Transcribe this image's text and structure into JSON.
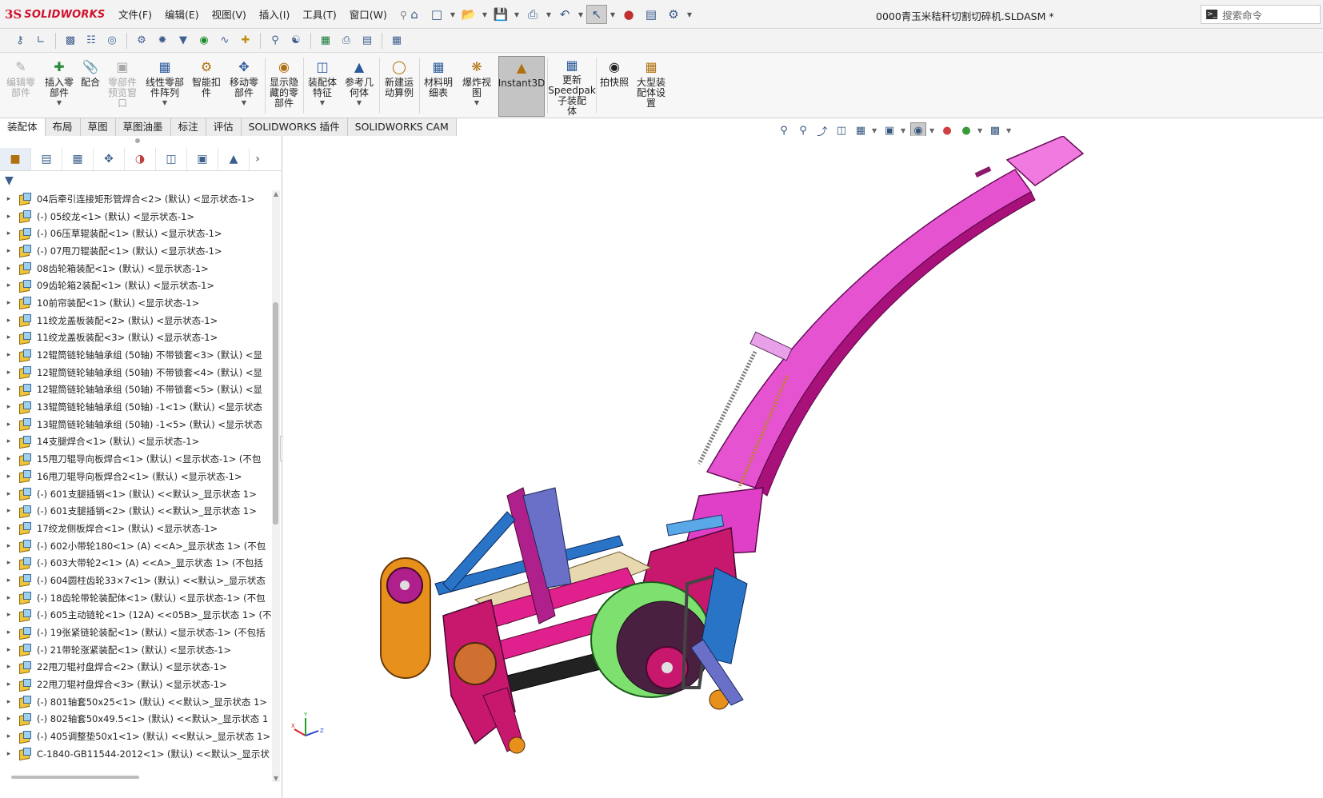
{
  "app": {
    "logo_mark": "3S",
    "logo_text": "SOLIDWORKS",
    "doc_title": "0000青玉米秸秆切割切碎机.SLDASM *",
    "search_placeholder": "搜索命令"
  },
  "menu": [
    "文件(F)",
    "编辑(E)",
    "视图(V)",
    "插入(I)",
    "工具(T)",
    "窗口(W)"
  ],
  "quick_access": [
    "home-icon",
    "new-icon",
    "open-icon",
    "save-icon",
    "print-icon",
    "undo-icon",
    "select-icon",
    "rebuild-icon",
    "options-icon",
    "settings-icon"
  ],
  "ribbon": [
    {
      "label": "编辑零\n部件",
      "disabled": true,
      "dd": false
    },
    {
      "label": "插入零\n部件",
      "disabled": false,
      "dd": true
    },
    {
      "label": "配合",
      "disabled": false,
      "dd": false
    },
    {
      "label": "零部件\n预览窗\n口",
      "disabled": true,
      "dd": false
    },
    {
      "label": "线性零部\n件阵列",
      "disabled": false,
      "dd": true
    },
    {
      "label": "智能扣\n件",
      "disabled": false,
      "dd": false
    },
    {
      "label": "移动零\n部件",
      "disabled": false,
      "dd": true
    },
    {
      "label": "显示隐\n藏的零\n部件",
      "disabled": false,
      "dd": false
    },
    {
      "label": "装配体\n特征",
      "disabled": false,
      "dd": true
    },
    {
      "label": "参考几\n何体",
      "disabled": false,
      "dd": true
    },
    {
      "label": "新建运\n动算例",
      "disabled": false,
      "dd": false
    },
    {
      "label": "材料明\n细表",
      "disabled": false,
      "dd": false
    },
    {
      "label": "爆炸视\n图",
      "disabled": false,
      "dd": true
    },
    {
      "label": "Instant3D",
      "disabled": false,
      "dd": false,
      "active": true
    },
    {
      "label": "更新\nSpeedpak\n子装配\n体",
      "disabled": false,
      "dd": false
    },
    {
      "label": "拍快照",
      "disabled": false,
      "dd": false
    },
    {
      "label": "大型装\n配体设\n置",
      "disabled": false,
      "dd": false
    }
  ],
  "tabs": [
    "装配体",
    "布局",
    "草图",
    "草图油墨",
    "标注",
    "评估",
    "SOLIDWORKS 插件",
    "SOLIDWORKS CAM"
  ],
  "tree": [
    "04后牵引连接矩形管焊合<2> (默认) <显示状态-1>",
    "(-) 05绞龙<1> (默认) <显示状态-1>",
    "(-) 06压草辊装配<1> (默认) <显示状态-1>",
    "(-) 07甩刀辊装配<1> (默认) <显示状态-1>",
    "08齿轮箱装配<1> (默认) <显示状态-1>",
    "09齿轮箱2装配<1> (默认) <显示状态-1>",
    "10前帘装配<1> (默认) <显示状态-1>",
    "11绞龙盖板装配<2> (默认) <显示状态-1>",
    "11绞龙盖板装配<3> (默认) <显示状态-1>",
    "12辊筒链轮轴轴承组 (50轴) 不带锁套<3> (默认) <显",
    "12辊筒链轮轴轴承组 (50轴) 不带锁套<4> (默认) <显",
    "12辊筒链轮轴轴承组 (50轴) 不带锁套<5> (默认) <显",
    "13辊筒链轮轴轴承组 (50轴) -1<1> (默认) <显示状态",
    "13辊筒链轮轴轴承组 (50轴) -1<5> (默认) <显示状态",
    "14支腿焊合<1> (默认) <显示状态-1>",
    "15甩刀辊导向板焊合<1> (默认) <显示状态-1> (不包",
    "16甩刀辊导向板焊合2<1> (默认) <显示状态-1>",
    "(-) 601支腿插销<1> (默认) <<默认>_显示状态 1>",
    "(-) 601支腿插销<2> (默认) <<默认>_显示状态 1>",
    "17绞龙侧板焊合<1> (默认) <显示状态-1>",
    "(-) 602小带轮180<1> (A) <<A>_显示状态 1> (不包",
    "(-) 603大带轮2<1> (A) <<A>_显示状态 1> (不包括",
    "(-) 604圆柱齿轮33×7<1> (默认) <<默认>_显示状态",
    "(-) 18齿轮带轮装配体<1> (默认) <显示状态-1> (不包",
    "(-) 605主动链轮<1> (12A) <<05B>_显示状态 1> (不",
    "(-) 19张紧链轮装配<1> (默认) <显示状态-1> (不包括",
    "(-) 21带轮涨紧装配<1> (默认) <显示状态-1>",
    "22甩刀辊衬盘焊合<2> (默认) <显示状态-1>",
    "22甩刀辊衬盘焊合<3> (默认) <显示状态-1>",
    "(-) 801轴套50x25<1> (默认) <<默认>_显示状态 1>",
    "(-) 802轴套50x49.5<1> (默认) <<默认>_显示状态 1",
    "(-) 405调整垫50x1<1> (默认) <<默认>_显示状态 1>",
    "C-1840-GB11544-2012<1> (默认) <<默认>_显示状"
  ],
  "triad": {
    "x": "X",
    "y": "Y",
    "z": "Z"
  },
  "colors": {
    "accent": "#d0112b",
    "chute": "#e040c8",
    "frame": "#c8186e",
    "blue": "#2a74c8",
    "green": "#7ee06e",
    "orange": "#e8901c"
  }
}
